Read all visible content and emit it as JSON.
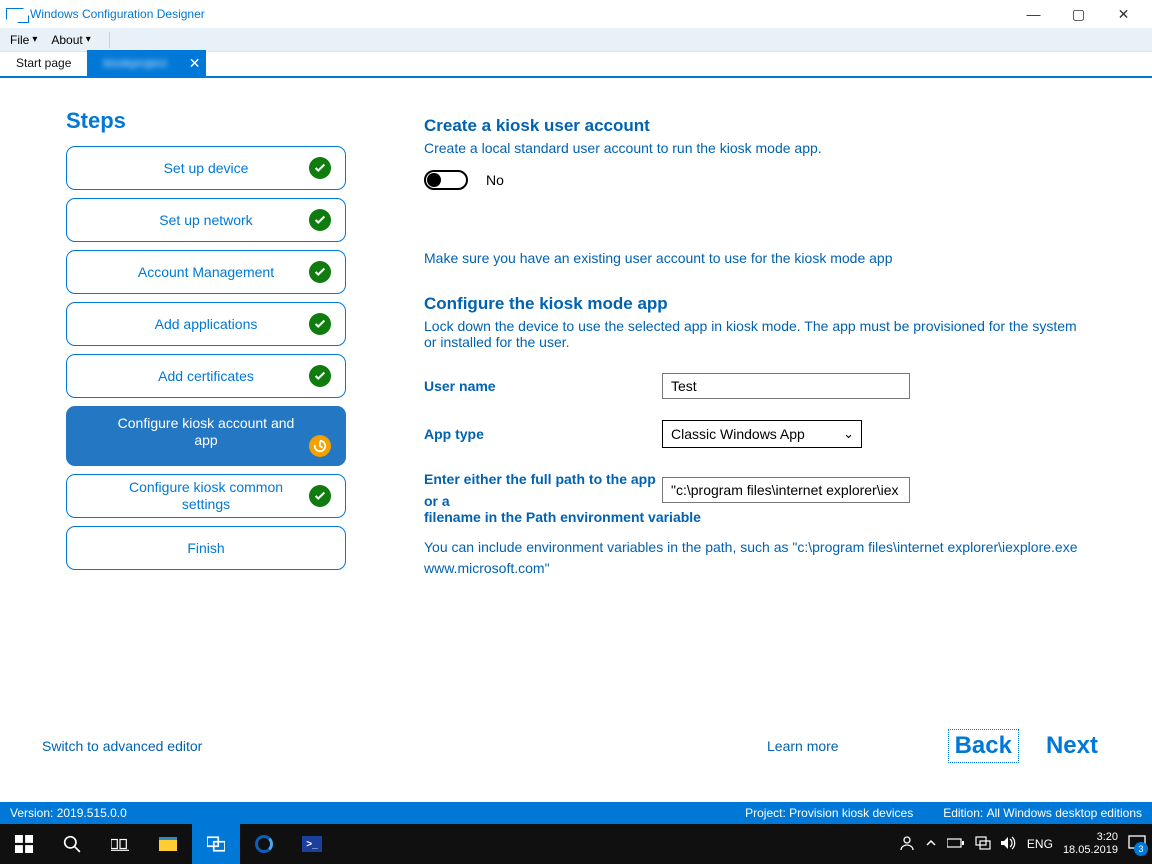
{
  "window": {
    "title": "Windows Configuration Designer"
  },
  "menu": {
    "file": "File",
    "about": "About"
  },
  "tabs": {
    "start": "Start page",
    "active_label": "kioskproject",
    "close_symbol": "✕"
  },
  "steps": {
    "title": "Steps",
    "items": [
      {
        "label": "Set up device",
        "status": "done"
      },
      {
        "label": "Set up network",
        "status": "done"
      },
      {
        "label": "Account Management",
        "status": "done"
      },
      {
        "label": "Add applications",
        "status": "done"
      },
      {
        "label": "Add certificates",
        "status": "done"
      },
      {
        "label": "Configure kiosk account and app",
        "status": "current"
      },
      {
        "label": "Configure kiosk common settings",
        "status": "done"
      },
      {
        "label": "Finish",
        "status": "none"
      }
    ]
  },
  "form": {
    "section1_heading": "Create a kiosk user account",
    "section1_desc": "Create a local standard user account to run the kiosk mode app.",
    "toggle_state_text": "No",
    "existing_note": "Make sure you have an existing user account to use for the kiosk mode app",
    "section2_heading": "Configure the kiosk mode app",
    "section2_desc": "Lock down the device to use the selected app in kiosk mode. The app must be provisioned for the system or installed for the user.",
    "username_label": "User name",
    "username_value": "Test",
    "apptype_label": "App type",
    "apptype_value": "Classic Windows App",
    "path_label_part1": "Enter either the full path to the app or a",
    "path_label_part2": "filename in the Path environment variable",
    "path_value": "\"c:\\program files\\internet explorer\\iex",
    "path_hint": "You can include environment variables in the path, such as \"c:\\program files\\internet explorer\\iexplore.exe www.microsoft.com\""
  },
  "bottom": {
    "switch_advanced": "Switch to advanced editor",
    "learn_more": "Learn more",
    "back": "Back",
    "next": "Next"
  },
  "statusbar": {
    "version_label": "Version:",
    "version_value": "2019.515.0.0",
    "project_label": "Project:",
    "project_value": "Provision kiosk devices",
    "edition_label": "Edition:",
    "edition_value": "All Windows desktop editions"
  },
  "taskbar": {
    "lang": "ENG",
    "time": "3:20",
    "date": "18.05.2019",
    "notif_count": "3"
  }
}
